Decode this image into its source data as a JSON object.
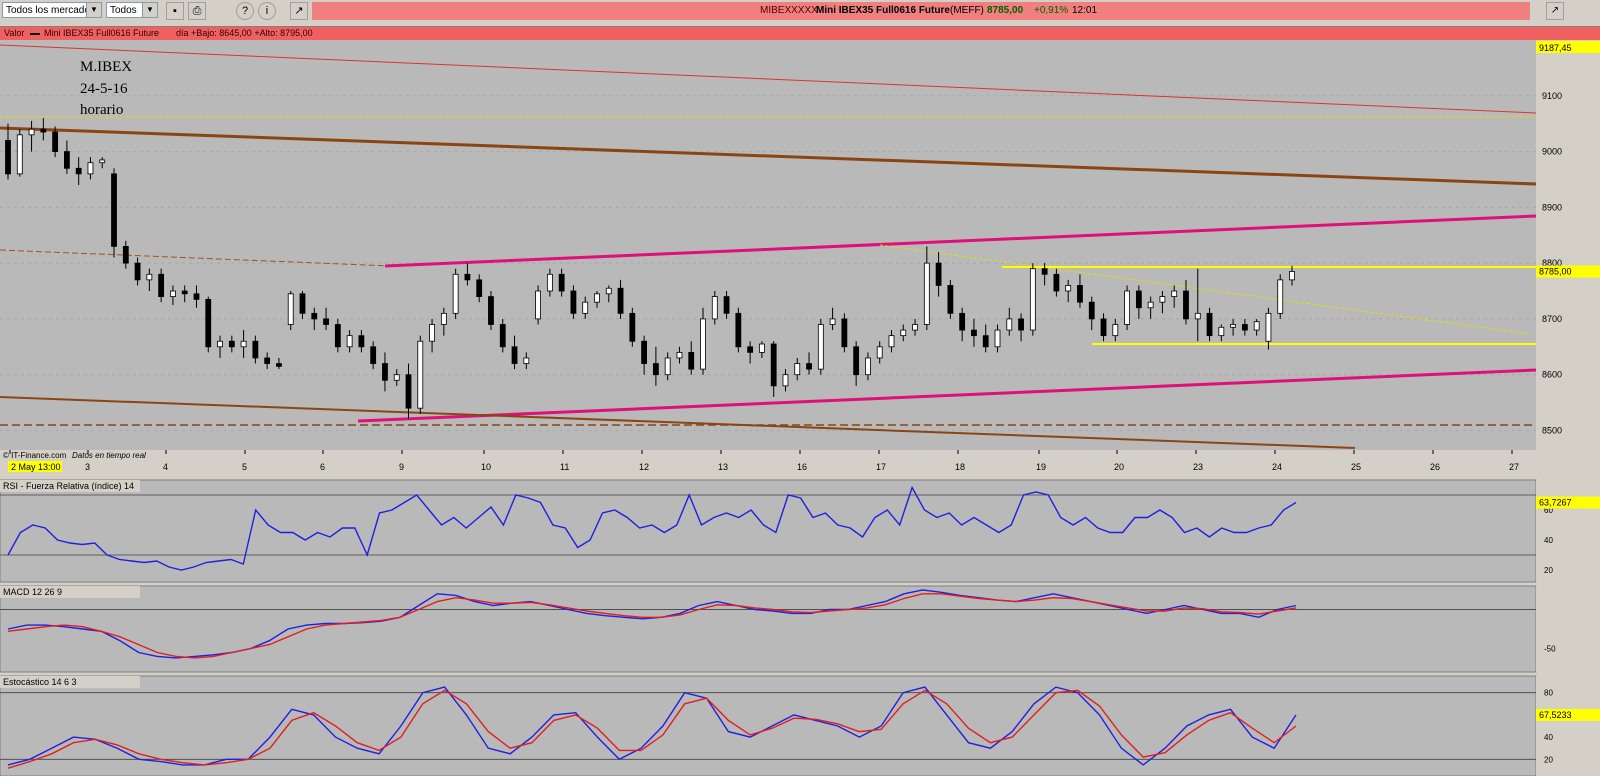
{
  "toolbar": {
    "market_select": "Todos los mercados",
    "filter_select": "Todos",
    "save_icon": "save-icon",
    "print_icon": "print-icon",
    "help_icon": "help-icon",
    "info_icon": "info-icon",
    "chart_icon": "chart-icon"
  },
  "ticker": {
    "code": "MIBEXXXXX",
    "name": "Mini IBEX35 Full0616 Future",
    "market": "(MEFF)",
    "price": "8785,00",
    "change": "+0,91%",
    "time": "12:01"
  },
  "infobar": {
    "label": "Valor",
    "series": "Mini IBEX35 Full0616 Future",
    "range": "día +Bajo: 8645,00 +Alto: 8795,00"
  },
  "chart_data": [
    {
      "type": "candlestick",
      "annotation": [
        "M.IBEX",
        "24-5-16",
        "horario"
      ],
      "credit": "© IT-Finance.com",
      "credit_note": "Datos en tiempo real",
      "ylim": [
        8465,
        9200
      ],
      "y_ticks": [
        8500,
        8600,
        8700,
        8800,
        8900,
        9000,
        9100
      ],
      "x_tick_labels": [
        "2 May 13:00",
        "3",
        "4",
        "5",
        "6",
        "9",
        "10",
        "11",
        "12",
        "13",
        "16",
        "17",
        "18",
        "19",
        "20",
        "23",
        "24",
        "25",
        "26",
        "27"
      ],
      "price_labels": {
        "top": "9187,45",
        "last": "8785,00"
      },
      "candles": [
        [
          9020,
          9050,
          8950,
          8960
        ],
        [
          8960,
          9040,
          8955,
          9030
        ],
        [
          9030,
          9055,
          9000,
          9040
        ],
        [
          9040,
          9060,
          9020,
          9035
        ],
        [
          9035,
          9045,
          8990,
          9000
        ],
        [
          9000,
          9020,
          8960,
          8970
        ],
        [
          8970,
          8990,
          8940,
          8960
        ],
        [
          8960,
          8990,
          8950,
          8980
        ],
        [
          8980,
          8990,
          8970,
          8985
        ],
        [
          8960,
          8970,
          8810,
          8830
        ],
        [
          8830,
          8840,
          8790,
          8800
        ],
        [
          8800,
          8810,
          8760,
          8770
        ],
        [
          8770,
          8790,
          8750,
          8780
        ],
        [
          8780,
          8790,
          8730,
          8740
        ],
        [
          8740,
          8760,
          8725,
          8750
        ],
        [
          8750,
          8760,
          8730,
          8745
        ],
        [
          8745,
          8760,
          8720,
          8735
        ],
        [
          8735,
          8740,
          8640,
          8650
        ],
        [
          8650,
          8670,
          8630,
          8660
        ],
        [
          8660,
          8670,
          8640,
          8650
        ],
        [
          8650,
          8680,
          8630,
          8660
        ],
        [
          8660,
          8670,
          8620,
          8630
        ],
        [
          8630,
          8640,
          8610,
          8620
        ],
        [
          8620,
          8630,
          8610,
          8615
        ],
        [
          8690,
          8750,
          8680,
          8745
        ],
        [
          8745,
          8750,
          8700,
          8710
        ],
        [
          8710,
          8720,
          8680,
          8700
        ],
        [
          8700,
          8720,
          8680,
          8690
        ],
        [
          8690,
          8700,
          8640,
          8650
        ],
        [
          8650,
          8680,
          8640,
          8670
        ],
        [
          8670,
          8680,
          8640,
          8650
        ],
        [
          8650,
          8660,
          8610,
          8620
        ],
        [
          8620,
          8640,
          8570,
          8590
        ],
        [
          8590,
          8610,
          8580,
          8600
        ],
        [
          8600,
          8620,
          8520,
          8540
        ],
        [
          8540,
          8670,
          8530,
          8660
        ],
        [
          8660,
          8700,
          8640,
          8690
        ],
        [
          8690,
          8720,
          8670,
          8710
        ],
        [
          8710,
          8790,
          8700,
          8780
        ],
        [
          8780,
          8800,
          8760,
          8770
        ],
        [
          8770,
          8780,
          8730,
          8740
        ],
        [
          8740,
          8750,
          8680,
          8690
        ],
        [
          8690,
          8700,
          8640,
          8650
        ],
        [
          8650,
          8670,
          8610,
          8620
        ],
        [
          8620,
          8640,
          8610,
          8630
        ],
        [
          8700,
          8760,
          8690,
          8750
        ],
        [
          8750,
          8790,
          8740,
          8780
        ],
        [
          8780,
          8790,
          8740,
          8750
        ],
        [
          8750,
          8760,
          8700,
          8710
        ],
        [
          8710,
          8740,
          8700,
          8730
        ],
        [
          8730,
          8750,
          8720,
          8745
        ],
        [
          8745,
          8760,
          8730,
          8755
        ],
        [
          8755,
          8770,
          8700,
          8710
        ],
        [
          8710,
          8720,
          8650,
          8660
        ],
        [
          8660,
          8670,
          8600,
          8620
        ],
        [
          8620,
          8650,
          8580,
          8600
        ],
        [
          8600,
          8640,
          8590,
          8630
        ],
        [
          8630,
          8650,
          8620,
          8640
        ],
        [
          8640,
          8660,
          8600,
          8610
        ],
        [
          8610,
          8720,
          8600,
          8700
        ],
        [
          8700,
          8750,
          8690,
          8740
        ],
        [
          8740,
          8750,
          8700,
          8710
        ],
        [
          8710,
          8720,
          8640,
          8650
        ],
        [
          8650,
          8660,
          8620,
          8640
        ],
        [
          8640,
          8660,
          8630,
          8655
        ],
        [
          8655,
          8660,
          8560,
          8580
        ],
        [
          8580,
          8610,
          8570,
          8600
        ],
        [
          8600,
          8630,
          8590,
          8620
        ],
        [
          8620,
          8640,
          8600,
          8610
        ],
        [
          8610,
          8700,
          8600,
          8690
        ],
        [
          8690,
          8720,
          8680,
          8700
        ],
        [
          8700,
          8710,
          8640,
          8650
        ],
        [
          8650,
          8660,
          8580,
          8600
        ],
        [
          8600,
          8640,
          8590,
          8630
        ],
        [
          8630,
          8660,
          8620,
          8650
        ],
        [
          8650,
          8680,
          8640,
          8670
        ],
        [
          8670,
          8690,
          8660,
          8680
        ],
        [
          8680,
          8700,
          8670,
          8690
        ],
        [
          8690,
          8830,
          8680,
          8800
        ],
        [
          8800,
          8820,
          8740,
          8760
        ],
        [
          8760,
          8770,
          8700,
          8710
        ],
        [
          8710,
          8720,
          8660,
          8680
        ],
        [
          8680,
          8700,
          8650,
          8670
        ],
        [
          8670,
          8690,
          8640,
          8650
        ],
        [
          8650,
          8690,
          8640,
          8680
        ],
        [
          8680,
          8720,
          8670,
          8700
        ],
        [
          8700,
          8710,
          8660,
          8680
        ],
        [
          8680,
          8800,
          8670,
          8790
        ],
        [
          8790,
          8800,
          8760,
          8780
        ],
        [
          8780,
          8790,
          8740,
          8750
        ],
        [
          8750,
          8770,
          8730,
          8760
        ],
        [
          8760,
          8780,
          8720,
          8730
        ],
        [
          8730,
          8740,
          8680,
          8700
        ],
        [
          8700,
          8710,
          8660,
          8670
        ],
        [
          8670,
          8700,
          8660,
          8690
        ],
        [
          8690,
          8760,
          8680,
          8750
        ],
        [
          8750,
          8760,
          8700,
          8720
        ],
        [
          8720,
          8740,
          8700,
          8730
        ],
        [
          8730,
          8750,
          8710,
          8740
        ],
        [
          8740,
          8760,
          8720,
          8750
        ],
        [
          8750,
          8770,
          8690,
          8700
        ],
        [
          8700,
          8790,
          8660,
          8710
        ],
        [
          8710,
          8720,
          8660,
          8670
        ],
        [
          8670,
          8690,
          8660,
          8685
        ],
        [
          8685,
          8700,
          8670,
          8690
        ],
        [
          8690,
          8700,
          8670,
          8680
        ],
        [
          8680,
          8700,
          8670,
          8695
        ],
        [
          8660,
          8720,
          8645,
          8710
        ],
        [
          8710,
          8780,
          8700,
          8770
        ],
        [
          8770,
          8795,
          8760,
          8785
        ]
      ]
    },
    {
      "type": "line",
      "title": "RSI - Fuerza Relativa (índice) 14",
      "y_ticks": [
        20,
        40,
        60
      ],
      "ylim": [
        12,
        80
      ],
      "last_label": "63,7267",
      "series": [
        {
          "values": [
            30,
            45,
            50,
            48,
            40,
            38,
            37,
            38,
            30,
            27,
            26,
            25,
            26,
            22,
            20,
            22,
            25,
            26,
            27,
            24,
            60,
            50,
            45,
            45,
            40,
            45,
            42,
            48,
            48,
            30,
            58,
            60,
            65,
            70,
            60,
            50,
            55,
            48,
            55,
            62,
            50,
            70,
            68,
            65,
            50,
            48,
            35,
            40,
            58,
            60,
            55,
            48,
            50,
            45,
            50,
            70,
            50,
            55,
            58,
            55,
            60,
            50,
            45,
            70,
            68,
            55,
            58,
            50,
            48,
            42,
            55,
            60,
            50,
            75,
            60,
            55,
            58,
            50,
            55,
            50,
            45,
            50,
            70,
            72,
            70,
            55,
            50,
            55,
            48,
            45,
            45,
            55,
            55,
            60,
            55,
            45,
            48,
            42,
            48,
            45,
            45,
            48,
            50,
            60,
            65
          ]
        }
      ]
    },
    {
      "type": "line",
      "title": "MACD 12 26 9",
      "y_ticks": [
        -50
      ],
      "ylim": [
        -80,
        30
      ],
      "series": [
        {
          "values": [
            -25,
            -20,
            -20,
            -22,
            -25,
            -28,
            -40,
            -55,
            -60,
            -62,
            -60,
            -58,
            -55,
            -50,
            -40,
            -25,
            -20,
            -18,
            -18,
            -17,
            -15,
            -10,
            5,
            20,
            18,
            10,
            5,
            8,
            10,
            5,
            0,
            -5,
            -8,
            -10,
            -12,
            -10,
            -5,
            5,
            10,
            5,
            0,
            -2,
            -5,
            -5,
            0,
            0,
            5,
            10,
            20,
            25,
            22,
            18,
            15,
            12,
            10,
            15,
            20,
            15,
            10,
            5,
            0,
            -5,
            0,
            5,
            0,
            -5,
            -5,
            -10,
            0,
            5
          ]
        },
        {
          "values": [
            -28,
            -25,
            -22,
            -20,
            -22,
            -28,
            -35,
            -45,
            -55,
            -60,
            -62,
            -60,
            -55,
            -50,
            -45,
            -35,
            -25,
            -20,
            -18,
            -16,
            -14,
            -10,
            0,
            10,
            15,
            12,
            8,
            8,
            9,
            6,
            2,
            -2,
            -5,
            -8,
            -10,
            -10,
            -7,
            0,
            6,
            5,
            2,
            0,
            -3,
            -4,
            -2,
            0,
            2,
            6,
            14,
            20,
            20,
            17,
            14,
            12,
            10,
            12,
            15,
            14,
            10,
            6,
            2,
            -2,
            -2,
            2,
            1,
            -3,
            -4,
            -6,
            -2,
            2
          ]
        }
      ]
    },
    {
      "type": "line",
      "title": "Estocástico 14 6 3",
      "y_ticks": [
        20,
        40,
        60,
        80
      ],
      "ylim": [
        5,
        95
      ],
      "last_label": "67,5233",
      "series": [
        {
          "values": [
            15,
            20,
            30,
            40,
            38,
            30,
            20,
            18,
            15,
            15,
            20,
            20,
            40,
            65,
            60,
            40,
            30,
            25,
            50,
            80,
            85,
            60,
            30,
            25,
            40,
            60,
            62,
            40,
            20,
            30,
            50,
            80,
            75,
            45,
            40,
            50,
            60,
            55,
            50,
            40,
            50,
            80,
            85,
            60,
            35,
            30,
            45,
            70,
            85,
            80,
            60,
            30,
            15,
            30,
            50,
            60,
            65,
            40,
            30,
            60
          ]
        },
        {
          "values": [
            12,
            18,
            25,
            35,
            38,
            33,
            25,
            20,
            17,
            15,
            17,
            20,
            30,
            55,
            62,
            50,
            35,
            28,
            40,
            70,
            82,
            70,
            45,
            30,
            35,
            55,
            60,
            48,
            28,
            28,
            42,
            70,
            75,
            55,
            42,
            48,
            57,
            56,
            52,
            45,
            47,
            70,
            82,
            70,
            48,
            35,
            40,
            60,
            80,
            82,
            68,
            42,
            22,
            26,
            42,
            55,
            62,
            48,
            35,
            50
          ]
        }
      ]
    }
  ]
}
